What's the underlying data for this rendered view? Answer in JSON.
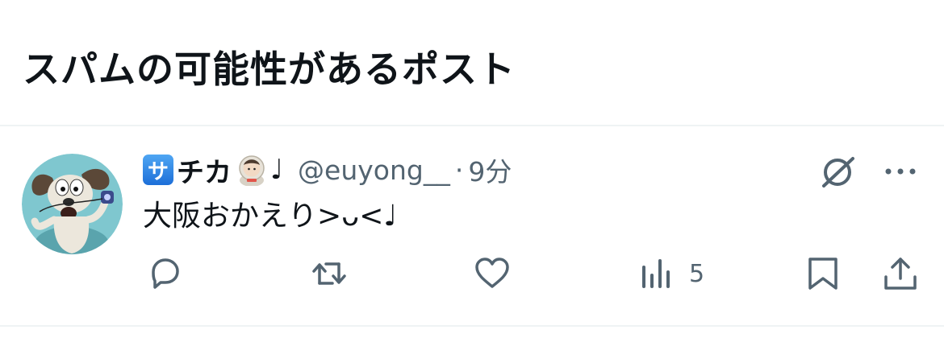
{
  "header": {
    "title": "スパムの可能性があるポスト"
  },
  "post": {
    "badge_char": "サ",
    "display_name": "チカ",
    "name_suffix": "♩",
    "handle": "@euyong__",
    "separator": "·",
    "time": "9分",
    "text": "大阪おかえり>ᴗ<♩",
    "avatar_icon": "dog-avatar-icon",
    "actions": {
      "reply_icon": "reply-icon",
      "repost_icon": "repost-icon",
      "like_icon": "heart-icon",
      "views_icon": "views-icon",
      "views_count": "5",
      "bookmark_icon": "bookmark-icon",
      "share_icon": "share-icon"
    }
  },
  "colors": {
    "text": "#0f1419",
    "secondary": "#536471",
    "divider": "#eff3f4",
    "badge": "#1d6fd8"
  }
}
